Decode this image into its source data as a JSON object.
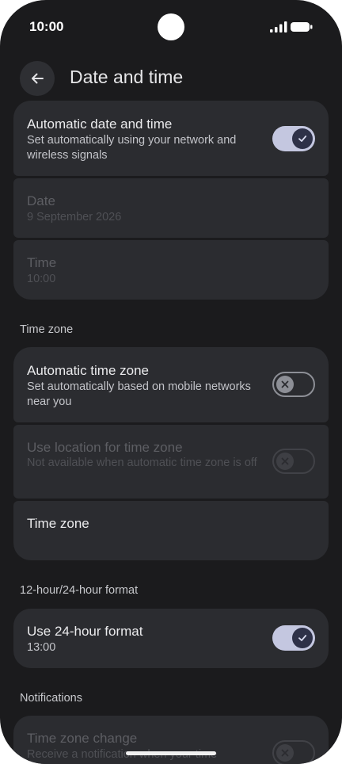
{
  "status_bar": {
    "time": "10:00"
  },
  "header": {
    "title": "Date and time"
  },
  "date_time_group": {
    "automatic": {
      "title": "Automatic date and time",
      "subtitle": "Set automatically using your network and wireless signals",
      "enabled": true
    },
    "date": {
      "title": "Date",
      "value": "9 September 2026"
    },
    "time": {
      "title": "Time",
      "value": "10:00"
    }
  },
  "time_zone_section": {
    "header": "Time zone",
    "automatic": {
      "title": "Automatic time zone",
      "subtitle": "Set automatically based on mobile networks near you",
      "enabled": false
    },
    "use_location": {
      "title": "Use location for time zone",
      "subtitle": "Not available when automatic time zone is off",
      "enabled": false
    },
    "time_zone": {
      "title": "Time zone"
    }
  },
  "format_section": {
    "header": "12-hour/24-hour format",
    "use_24": {
      "title": "Use 24-hour format",
      "subtitle": "13:00",
      "enabled": true
    }
  },
  "notifications_section": {
    "header": "Notifications",
    "tz_change": {
      "title": "Time zone change",
      "subtitle": "Receive a notification when your time",
      "enabled": false
    }
  },
  "icons": {
    "back": "arrow-back-icon",
    "check": "check-icon",
    "close": "close-icon",
    "signal": "signal-icon",
    "battery": "battery-icon"
  },
  "colors": {
    "background": "#1b1b1d",
    "card": "#2b2c30",
    "toggle_on": "#c4c7e0"
  }
}
